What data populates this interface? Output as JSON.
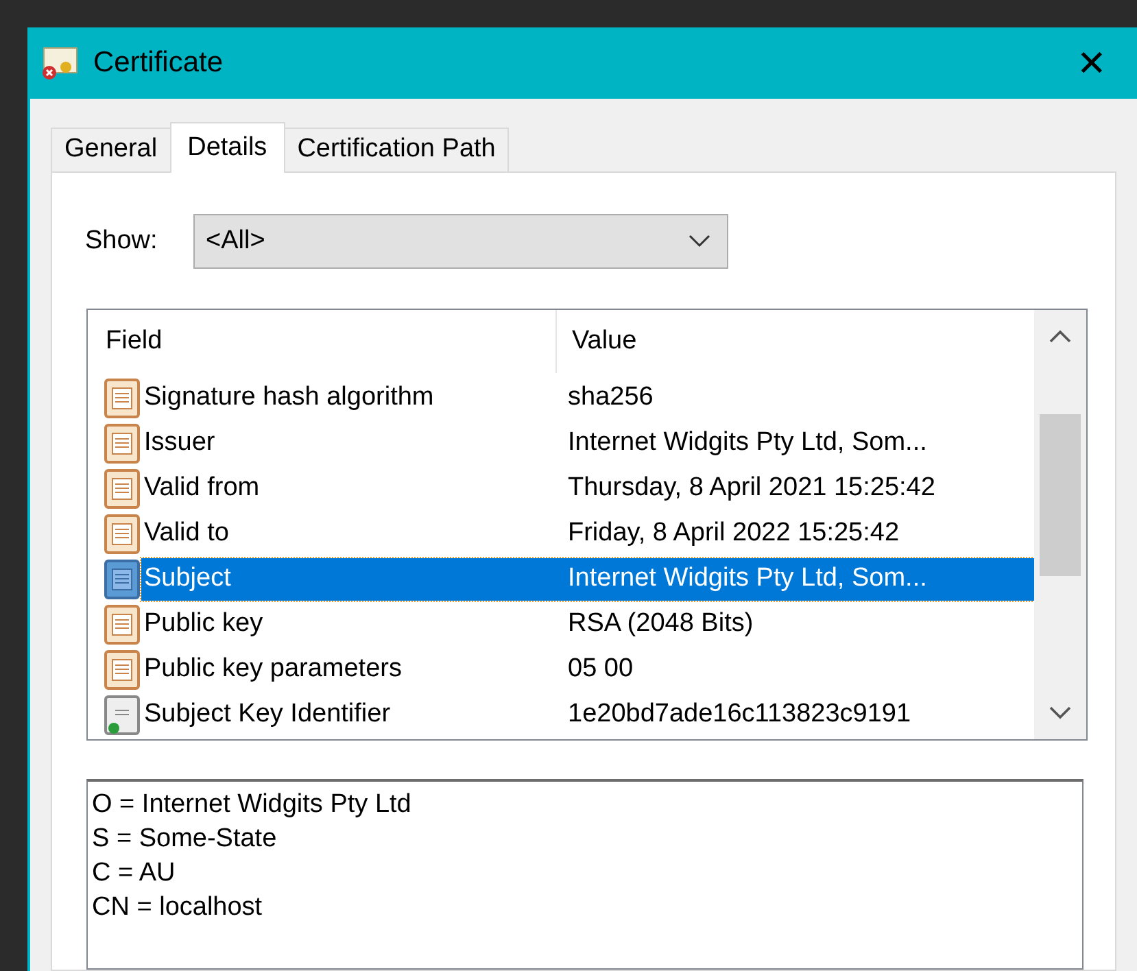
{
  "window": {
    "title": "Certificate",
    "close": "✕"
  },
  "tabs": [
    {
      "label": "General",
      "selected": false
    },
    {
      "label": "Details",
      "selected": true
    },
    {
      "label": "Certification Path",
      "selected": false
    }
  ],
  "show": {
    "label": "Show:",
    "value": "<All>"
  },
  "table": {
    "columns": [
      "Field",
      "Value"
    ],
    "rows": [
      {
        "kind": "field",
        "field": "Signature hash algorithm",
        "value": "sha256",
        "selected": false
      },
      {
        "kind": "field",
        "field": "Issuer",
        "value": "Internet Widgits Pty Ltd, Som...",
        "selected": false
      },
      {
        "kind": "field",
        "field": "Valid from",
        "value": "Thursday, 8 April 2021 15:25:42",
        "selected": false
      },
      {
        "kind": "field",
        "field": "Valid to",
        "value": "Friday, 8 April 2022 15:25:42",
        "selected": false
      },
      {
        "kind": "field",
        "field": "Subject",
        "value": "Internet Widgits Pty Ltd, Som...",
        "selected": true
      },
      {
        "kind": "field",
        "field": "Public key",
        "value": "RSA (2048 Bits)",
        "selected": false
      },
      {
        "kind": "field",
        "field": "Public key parameters",
        "value": "05 00",
        "selected": false
      },
      {
        "kind": "extension",
        "field": "Subject Key Identifier",
        "value": "1e20bd7ade16c113823c9191",
        "selected": false
      }
    ]
  },
  "detail_lines": [
    "O = Internet Widgits Pty Ltd",
    "S = Some-State",
    "C = AU",
    "CN = localhost"
  ]
}
